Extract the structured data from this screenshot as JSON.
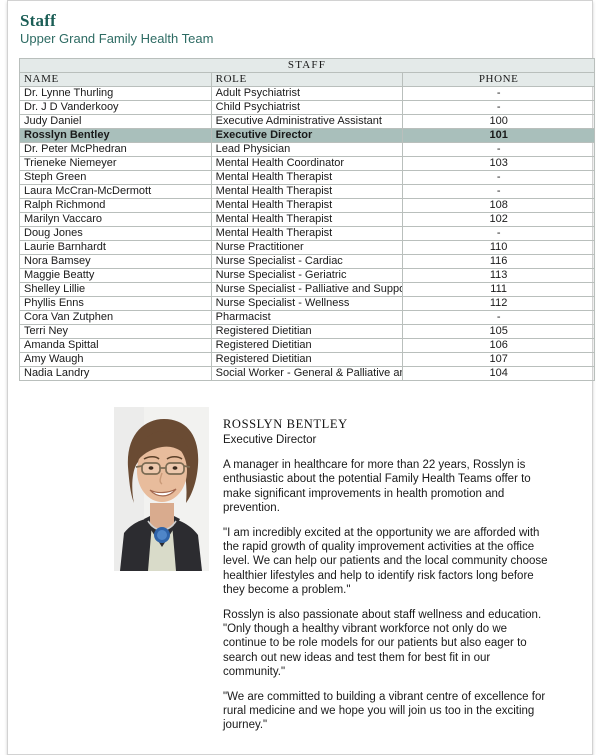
{
  "header": {
    "title": "Staff",
    "subtitle": "Upper Grand Family Health Team",
    "title_color": "#1b5e56"
  },
  "table": {
    "caption": "STAFF",
    "columns": [
      "NAME",
      "ROLE",
      "PHONE"
    ],
    "highlight_color": "#a9bfbb",
    "header_color": "#e4eae9",
    "rows": [
      {
        "name": "Dr. Lynne Thurling",
        "role": "Adult Psychiatrist",
        "phone": "-",
        "highlighted": false
      },
      {
        "name": "Dr. J D Vanderkooy",
        "role": "Child Psychiatrist",
        "phone": "-",
        "highlighted": false
      },
      {
        "name": "Judy Daniel",
        "role": "Executive Administrative Assistant",
        "phone": "100",
        "highlighted": false
      },
      {
        "name": "Rosslyn Bentley",
        "role": "Executive Director",
        "phone": "101",
        "highlighted": true
      },
      {
        "name": "Dr. Peter McPhedran",
        "role": "Lead Physician",
        "phone": "-",
        "highlighted": false
      },
      {
        "name": "Trieneke Niemeyer",
        "role": "Mental Health Coordinator",
        "phone": "103",
        "highlighted": false
      },
      {
        "name": "Steph Green",
        "role": "Mental Health Therapist",
        "phone": "-",
        "highlighted": false
      },
      {
        "name": "Laura McCran-McDermott",
        "role": "Mental Health Therapist",
        "phone": "-",
        "highlighted": false
      },
      {
        "name": "Ralph Richmond",
        "role": "Mental Health Therapist",
        "phone": "108",
        "highlighted": false
      },
      {
        "name": "Marilyn Vaccaro",
        "role": "Mental Health Therapist",
        "phone": "102",
        "highlighted": false
      },
      {
        "name": "Doug Jones",
        "role": "Mental Health Therapist",
        "phone": "-",
        "highlighted": false
      },
      {
        "name": "Laurie Barnhardt",
        "role": "Nurse Practitioner",
        "phone": "110",
        "highlighted": false
      },
      {
        "name": "Nora Bamsey",
        "role": "Nurse Specialist - Cardiac",
        "phone": "116",
        "highlighted": false
      },
      {
        "name": "Maggie Beatty",
        "role": "Nurse Specialist - Geriatric",
        "phone": "113",
        "highlighted": false
      },
      {
        "name": "Shelley Lillie",
        "role": "Nurse Specialist - Palliative and Supportive Care",
        "phone": "111",
        "highlighted": false
      },
      {
        "name": "Phyllis Enns",
        "role": "Nurse Specialist - Wellness",
        "phone": "112",
        "highlighted": false
      },
      {
        "name": "Cora Van Zutphen",
        "role": "Pharmacist",
        "phone": "-",
        "highlighted": false
      },
      {
        "name": "Terri Ney",
        "role": "Registered Dietitian",
        "phone": "105",
        "highlighted": false
      },
      {
        "name": "Amanda Spittal",
        "role": "Registered Dietitian",
        "phone": "106",
        "highlighted": false
      },
      {
        "name": "Amy Waugh",
        "role": "Registered Dietitian",
        "phone": "107",
        "highlighted": false
      },
      {
        "name": "Nadia Landry",
        "role": "Social Worker - General & Palliative and Supportive Care",
        "phone": "104",
        "highlighted": false
      }
    ]
  },
  "profile": {
    "photo_alt": "staff-portrait-photo",
    "name": "ROSSLYN BENTLEY",
    "role": "Executive Director",
    "paragraphs": [
      "A manager in healthcare for more than 22 years, Rosslyn is enthusiastic about the potential Family Health Teams offer to make significant improvements in health promotion and prevention.",
      "\"I am incredibly excited at the opportunity we are afforded with the rapid growth of quality improvement activities at the office level. We can help our patients and the local community choose healthier lifestyles and help to identify risk factors long before they become a problem.\"",
      "Rosslyn is also passionate about staff wellness and education. \"Only though a healthy vibrant workforce not only do we continue to be role models for our patients but also eager to search out new ideas and test them for best fit in our community.\"",
      "\"We are committed to building a vibrant centre of excellence for rural medicine and we hope you will join us too in the exciting journey.\""
    ]
  }
}
